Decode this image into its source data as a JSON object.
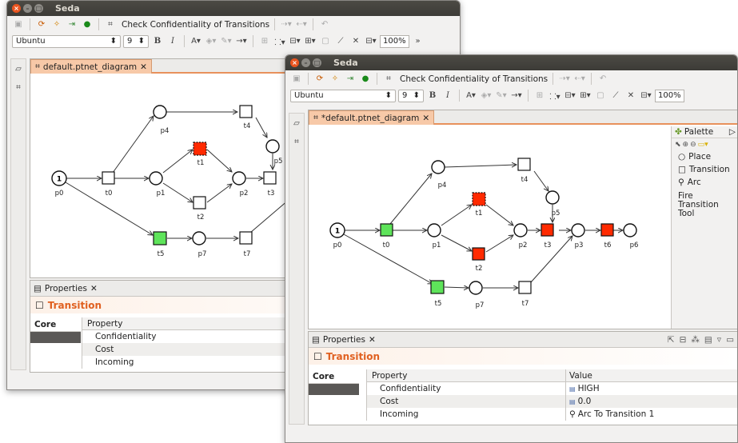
{
  "window_back": {
    "title": "Seda",
    "toolbar": {
      "check_label": "Check Confidentiality of Transitions",
      "font_name": "Ubuntu",
      "font_size": "9",
      "zoom": "100%",
      "overflow": "»"
    },
    "editor_tab": "default.ptnet_diagram",
    "properties": {
      "tab_label": "Properties",
      "section_title": "Transition",
      "core_label": "Core",
      "column_property": "Property",
      "rows": [
        "Confidentiality",
        "Cost",
        "Incoming"
      ]
    }
  },
  "window_front": {
    "title": "Seda",
    "toolbar": {
      "check_label": "Check Confidentiality of Transitions",
      "font_name": "Ubuntu",
      "font_size": "9",
      "zoom": "100%"
    },
    "editor_tab": "*default.ptnet_diagram",
    "palette": {
      "title": "Palette",
      "items": [
        {
          "label": "Place",
          "icon": "circle-icon"
        },
        {
          "label": "Transition",
          "icon": "square-icon"
        },
        {
          "label": "Arc",
          "icon": "arc-icon"
        },
        {
          "label": "Fire Transition Tool",
          "icon": ""
        }
      ]
    },
    "properties": {
      "tab_label": "Properties",
      "section_title": "Transition",
      "core_label": "Core",
      "column_property": "Property",
      "column_value": "Value",
      "rows": [
        {
          "property": "Confidentiality",
          "value": "HIGH"
        },
        {
          "property": "Cost",
          "value": "0.0"
        },
        {
          "property": "Incoming",
          "value": "Arc To Transition 1"
        }
      ]
    }
  },
  "diagram_back": {
    "places": [
      {
        "id": "p0",
        "label": "p0",
        "token": "1"
      },
      {
        "id": "p4",
        "label": "p4"
      },
      {
        "id": "p1",
        "label": "p1"
      },
      {
        "id": "p2",
        "label": "p2"
      },
      {
        "id": "p5",
        "label": "p5"
      },
      {
        "id": "p7",
        "label": "p7"
      }
    ],
    "transitions": [
      {
        "id": "t0",
        "label": "t0",
        "state": "normal"
      },
      {
        "id": "t4",
        "label": "t4",
        "state": "normal"
      },
      {
        "id": "t1",
        "label": "t1",
        "state": "red-selected"
      },
      {
        "id": "t2",
        "label": "t2",
        "state": "normal"
      },
      {
        "id": "t3",
        "label": "t3",
        "state": "normal"
      },
      {
        "id": "t5",
        "label": "t5",
        "state": "green"
      },
      {
        "id": "t7",
        "label": "t7",
        "state": "normal"
      }
    ]
  },
  "diagram_front": {
    "places": [
      {
        "id": "p0",
        "label": "p0",
        "token": "1"
      },
      {
        "id": "p4",
        "label": "p4"
      },
      {
        "id": "p1",
        "label": "p1"
      },
      {
        "id": "p2",
        "label": "p2"
      },
      {
        "id": "p5",
        "label": "p5"
      },
      {
        "id": "p3",
        "label": "p3"
      },
      {
        "id": "p6",
        "label": "p6"
      },
      {
        "id": "p7",
        "label": "p7"
      }
    ],
    "transitions": [
      {
        "id": "t0",
        "label": "t0",
        "state": "green"
      },
      {
        "id": "t4",
        "label": "t4",
        "state": "normal"
      },
      {
        "id": "t1",
        "label": "t1",
        "state": "red-selected"
      },
      {
        "id": "t2",
        "label": "t2",
        "state": "red"
      },
      {
        "id": "t3",
        "label": "t3",
        "state": "red"
      },
      {
        "id": "t6",
        "label": "t6",
        "state": "red"
      },
      {
        "id": "t5",
        "label": "t5",
        "state": "green"
      },
      {
        "id": "t7",
        "label": "t7",
        "state": "normal"
      }
    ]
  },
  "colors": {
    "red": "#ff2a00",
    "green": "#5ee45a",
    "accent": "#e8915c",
    "title_bar": "#3c3b37"
  }
}
